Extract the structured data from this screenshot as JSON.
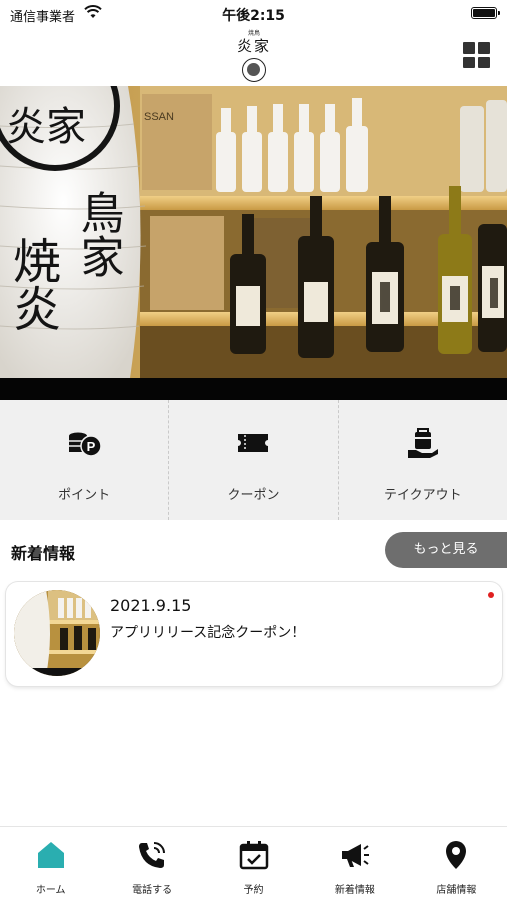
{
  "status_bar": {
    "carrier": "通信事業者",
    "time": "午後2:15"
  },
  "header": {
    "logo_small": "焼鳥",
    "logo_main": "炎家",
    "menu_icon": "grid-icon"
  },
  "hero": {
    "lantern_top": "炎家",
    "lantern_col1": "焼炎",
    "lantern_col2": "鳥家",
    "box_label": "SSAN"
  },
  "quick_actions": [
    {
      "label": "ポイント",
      "icon": "coins-point-icon"
    },
    {
      "label": "クーポン",
      "icon": "ticket-icon"
    },
    {
      "label": "テイクアウト",
      "icon": "takeout-bag-icon"
    }
  ],
  "news": {
    "title": "新着情報",
    "more_label": "もっと見る",
    "items": [
      {
        "date": "2021.9.15",
        "text": "アプリリリース記念クーポン！",
        "unread": true
      }
    ]
  },
  "tab_bar": [
    {
      "label": "ホーム",
      "icon": "home-icon",
      "active": true
    },
    {
      "label": "電話する",
      "icon": "phone-icon",
      "active": false
    },
    {
      "label": "予約",
      "icon": "calendar-check-icon",
      "active": false
    },
    {
      "label": "新着情報",
      "icon": "megaphone-icon",
      "active": false
    },
    {
      "label": "店舗情報",
      "icon": "map-pin-icon",
      "active": false
    }
  ],
  "colors": {
    "accent": "#2aaeb0",
    "more_button": "#6e6e6e",
    "quick_bg": "#f0f0f0",
    "unread": "#e02020"
  }
}
